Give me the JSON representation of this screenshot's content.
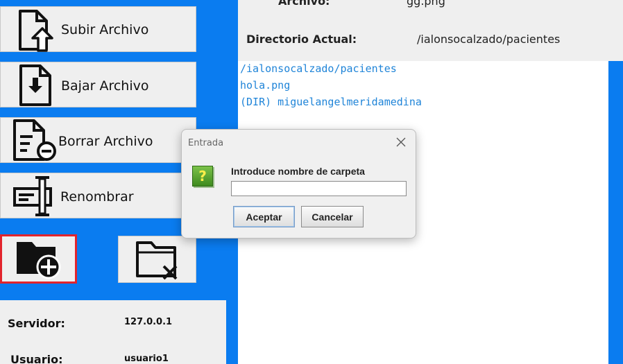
{
  "sidebar": {
    "upload_label": "Subir Archivo",
    "download_label": "Bajar Archivo",
    "delete_label": "Borrar Archivo",
    "rename_label": "Renombrar",
    "new_folder_icon": "folder-add-icon",
    "delete_folder_icon": "folder-delete-icon",
    "new_folder_highlight": "#e2242c"
  },
  "connection": {
    "server_label": "Servidor:",
    "server_value": "127.0.0.1",
    "user_label": "Usuario:",
    "user_value": "usuario1"
  },
  "file_info": {
    "file_label": "Archivo:",
    "file_value": "gg.png",
    "dir_label": "Directorio Actual:",
    "dir_value": "/ialonsocalzado/pacientes"
  },
  "listing": {
    "lines": [
      "/ialonsocalzado/pacientes",
      "hola.png",
      "(DIR) miguelangelmeridamedina"
    ],
    "text_color": "#1f84d8"
  },
  "dialog": {
    "title": "Entrada",
    "prompt": "Introduce nombre de carpeta",
    "input_value": "",
    "ok_label": "Aceptar",
    "cancel_label": "Cancelar",
    "icon": "question-icon"
  },
  "colors": {
    "background": "#0a7cf0",
    "panel": "#efefef"
  }
}
